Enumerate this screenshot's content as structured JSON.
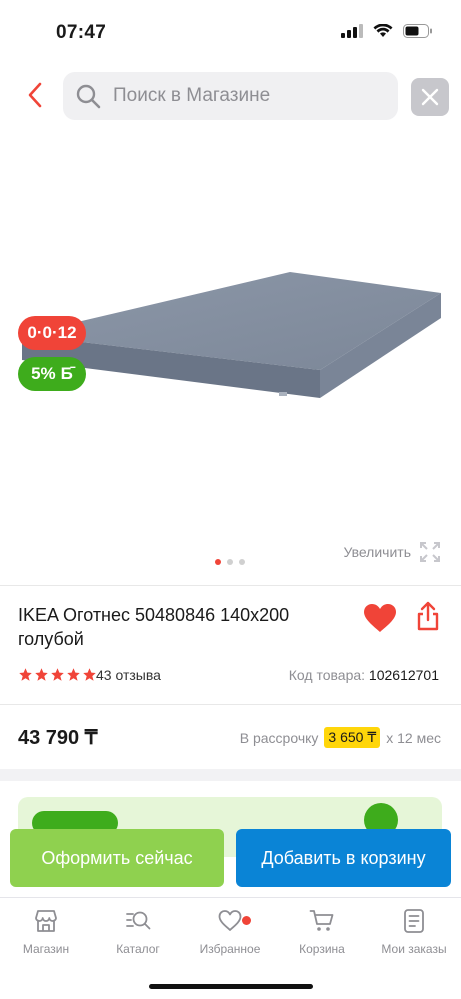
{
  "status": {
    "time": "07:47"
  },
  "search": {
    "placeholder": "Поиск в Магазине"
  },
  "badges": {
    "timer": "0·0·12",
    "cashback": "5%"
  },
  "gallery": {
    "zoom_label": "Увеличить",
    "page_count": 3,
    "active_page": 1
  },
  "product": {
    "title": "IKEA Оготнес 50480846 140x200 голубой",
    "rating": 5,
    "reviews": "43 отзыва",
    "sku_label": "Код товара:",
    "sku": "102612701",
    "price": "43 790 ₸",
    "installment_label": "В рассрочку",
    "installment_amount": "3 650 ₸",
    "installment_term": "х 12 мес"
  },
  "actions": {
    "buy_now": "Оформить сейчас",
    "add_to_cart": "Добавить в корзину"
  },
  "tabs": [
    {
      "label": "Магазин",
      "icon": "store-icon"
    },
    {
      "label": "Каталог",
      "icon": "catalog-search-icon"
    },
    {
      "label": "Избранное",
      "icon": "heart-icon"
    },
    {
      "label": "Корзина",
      "icon": "cart-icon"
    },
    {
      "label": "Мои заказы",
      "icon": "orders-icon"
    }
  ],
  "colors": {
    "accent": "#f04438",
    "green": "#3eac1c",
    "blue": "#0a84d6",
    "light_green": "#8fd14f",
    "highlight": "#ffd60a"
  }
}
